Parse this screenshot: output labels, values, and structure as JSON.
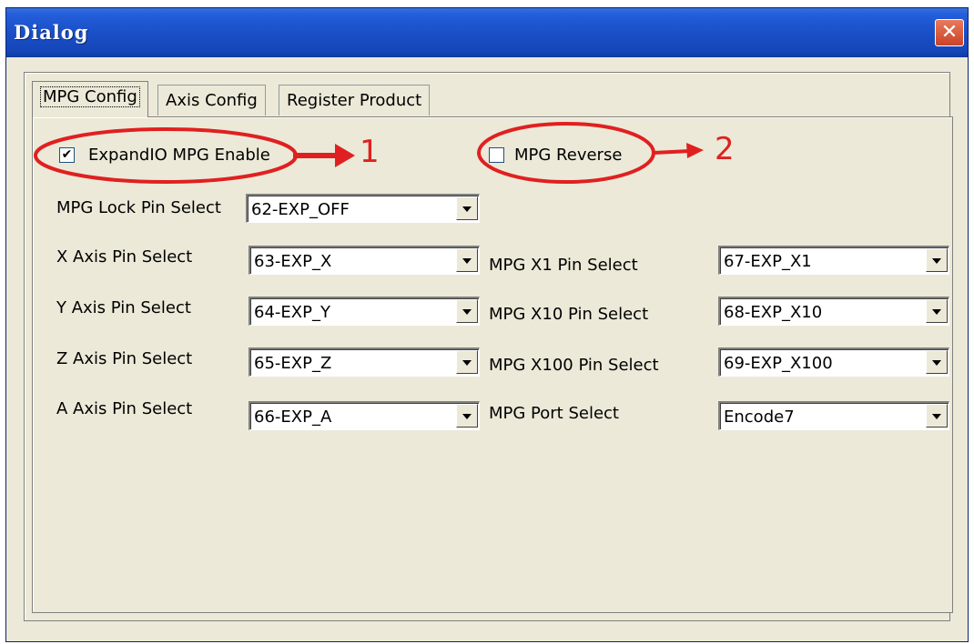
{
  "window": {
    "title": "Dialog",
    "close_glyph": "✕"
  },
  "tabs": [
    "MPG Config",
    "Axis Config",
    "Register Product"
  ],
  "checkboxes": {
    "expandio": {
      "label": "ExpandIO MPG Enable",
      "checked": true,
      "mark": "✔"
    },
    "reverse": {
      "label": "MPG Reverse",
      "checked": false,
      "mark": ""
    }
  },
  "left_fields": [
    {
      "label": "MPG Lock Pin Select",
      "value": "62-EXP_OFF"
    },
    {
      "label": "X Axis Pin Select",
      "value": "63-EXP_X"
    },
    {
      "label": "Y Axis Pin Select",
      "value": "64-EXP_Y"
    },
    {
      "label": "Z Axis Pin Select",
      "value": "65-EXP_Z"
    },
    {
      "label": "A Axis Pin Select",
      "value": "66-EXP_A"
    }
  ],
  "right_fields": [
    {
      "label": "MPG X1 Pin Select",
      "value": "67-EXP_X1"
    },
    {
      "label": "MPG X10 Pin Select",
      "value": "68-EXP_X10"
    },
    {
      "label": "MPG X100 Pin Select",
      "value": "69-EXP_X100"
    },
    {
      "label": "MPG Port Select",
      "value": "Encode7"
    }
  ],
  "annotations": {
    "one": "1",
    "two": "2",
    "color": "#e02020"
  },
  "icons": {
    "close": "close-icon",
    "dropdown": "chevron-down-icon",
    "check": "checkmark-icon"
  }
}
